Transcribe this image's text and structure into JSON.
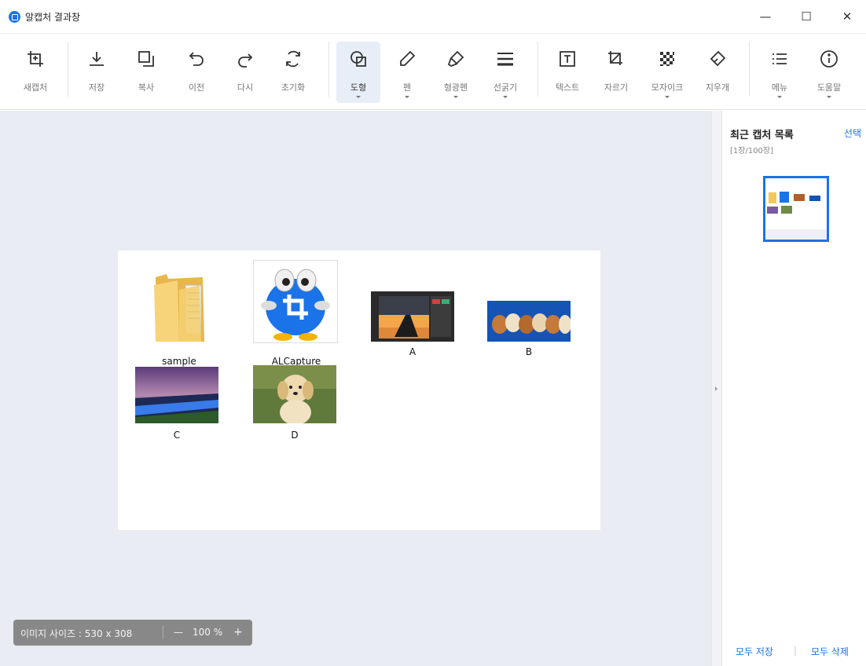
{
  "window": {
    "title": "알캡처 결과창",
    "minimize": "—",
    "maximize": "☐",
    "close": "✕"
  },
  "toolbar": {
    "items": [
      {
        "id": "new-capture",
        "label": "새캡처"
      },
      {
        "id": "save",
        "label": "저장"
      },
      {
        "id": "copy",
        "label": "복사"
      },
      {
        "id": "undo",
        "label": "이전"
      },
      {
        "id": "redo",
        "label": "다시"
      },
      {
        "id": "reset",
        "label": "초기화"
      },
      {
        "id": "shape",
        "label": "도형"
      },
      {
        "id": "pen",
        "label": "펜"
      },
      {
        "id": "highlighter",
        "label": "형광펜"
      },
      {
        "id": "line-width",
        "label": "선굵기"
      },
      {
        "id": "text",
        "label": "텍스트"
      },
      {
        "id": "crop",
        "label": "자르기"
      },
      {
        "id": "mosaic",
        "label": "모자이크"
      },
      {
        "id": "eraser",
        "label": "지우개"
      },
      {
        "id": "menu",
        "label": "메뉴"
      },
      {
        "id": "help",
        "label": "도움말"
      }
    ],
    "active": "shape",
    "accent_color": "#1a73e8"
  },
  "captured_image": {
    "items": [
      {
        "name": "sample",
        "kind": "folder"
      },
      {
        "name": "ALCapture",
        "kind": "app-icon"
      },
      {
        "name": "A",
        "kind": "image"
      },
      {
        "name": "B",
        "kind": "image"
      },
      {
        "name": "C",
        "kind": "image"
      },
      {
        "name": "D",
        "kind": "image"
      }
    ]
  },
  "status": {
    "size_text": "이미지 사이즈 : 530 x 308",
    "zoom_minus": "—",
    "zoom_value": "100 %",
    "zoom_plus": "+"
  },
  "sidebar": {
    "title": "최근 캡처 목록",
    "select_label": "선택",
    "count_text": "[1장/100장]",
    "save_all": "모두 저장",
    "delete_all": "모두 삭제",
    "divider": "|"
  }
}
